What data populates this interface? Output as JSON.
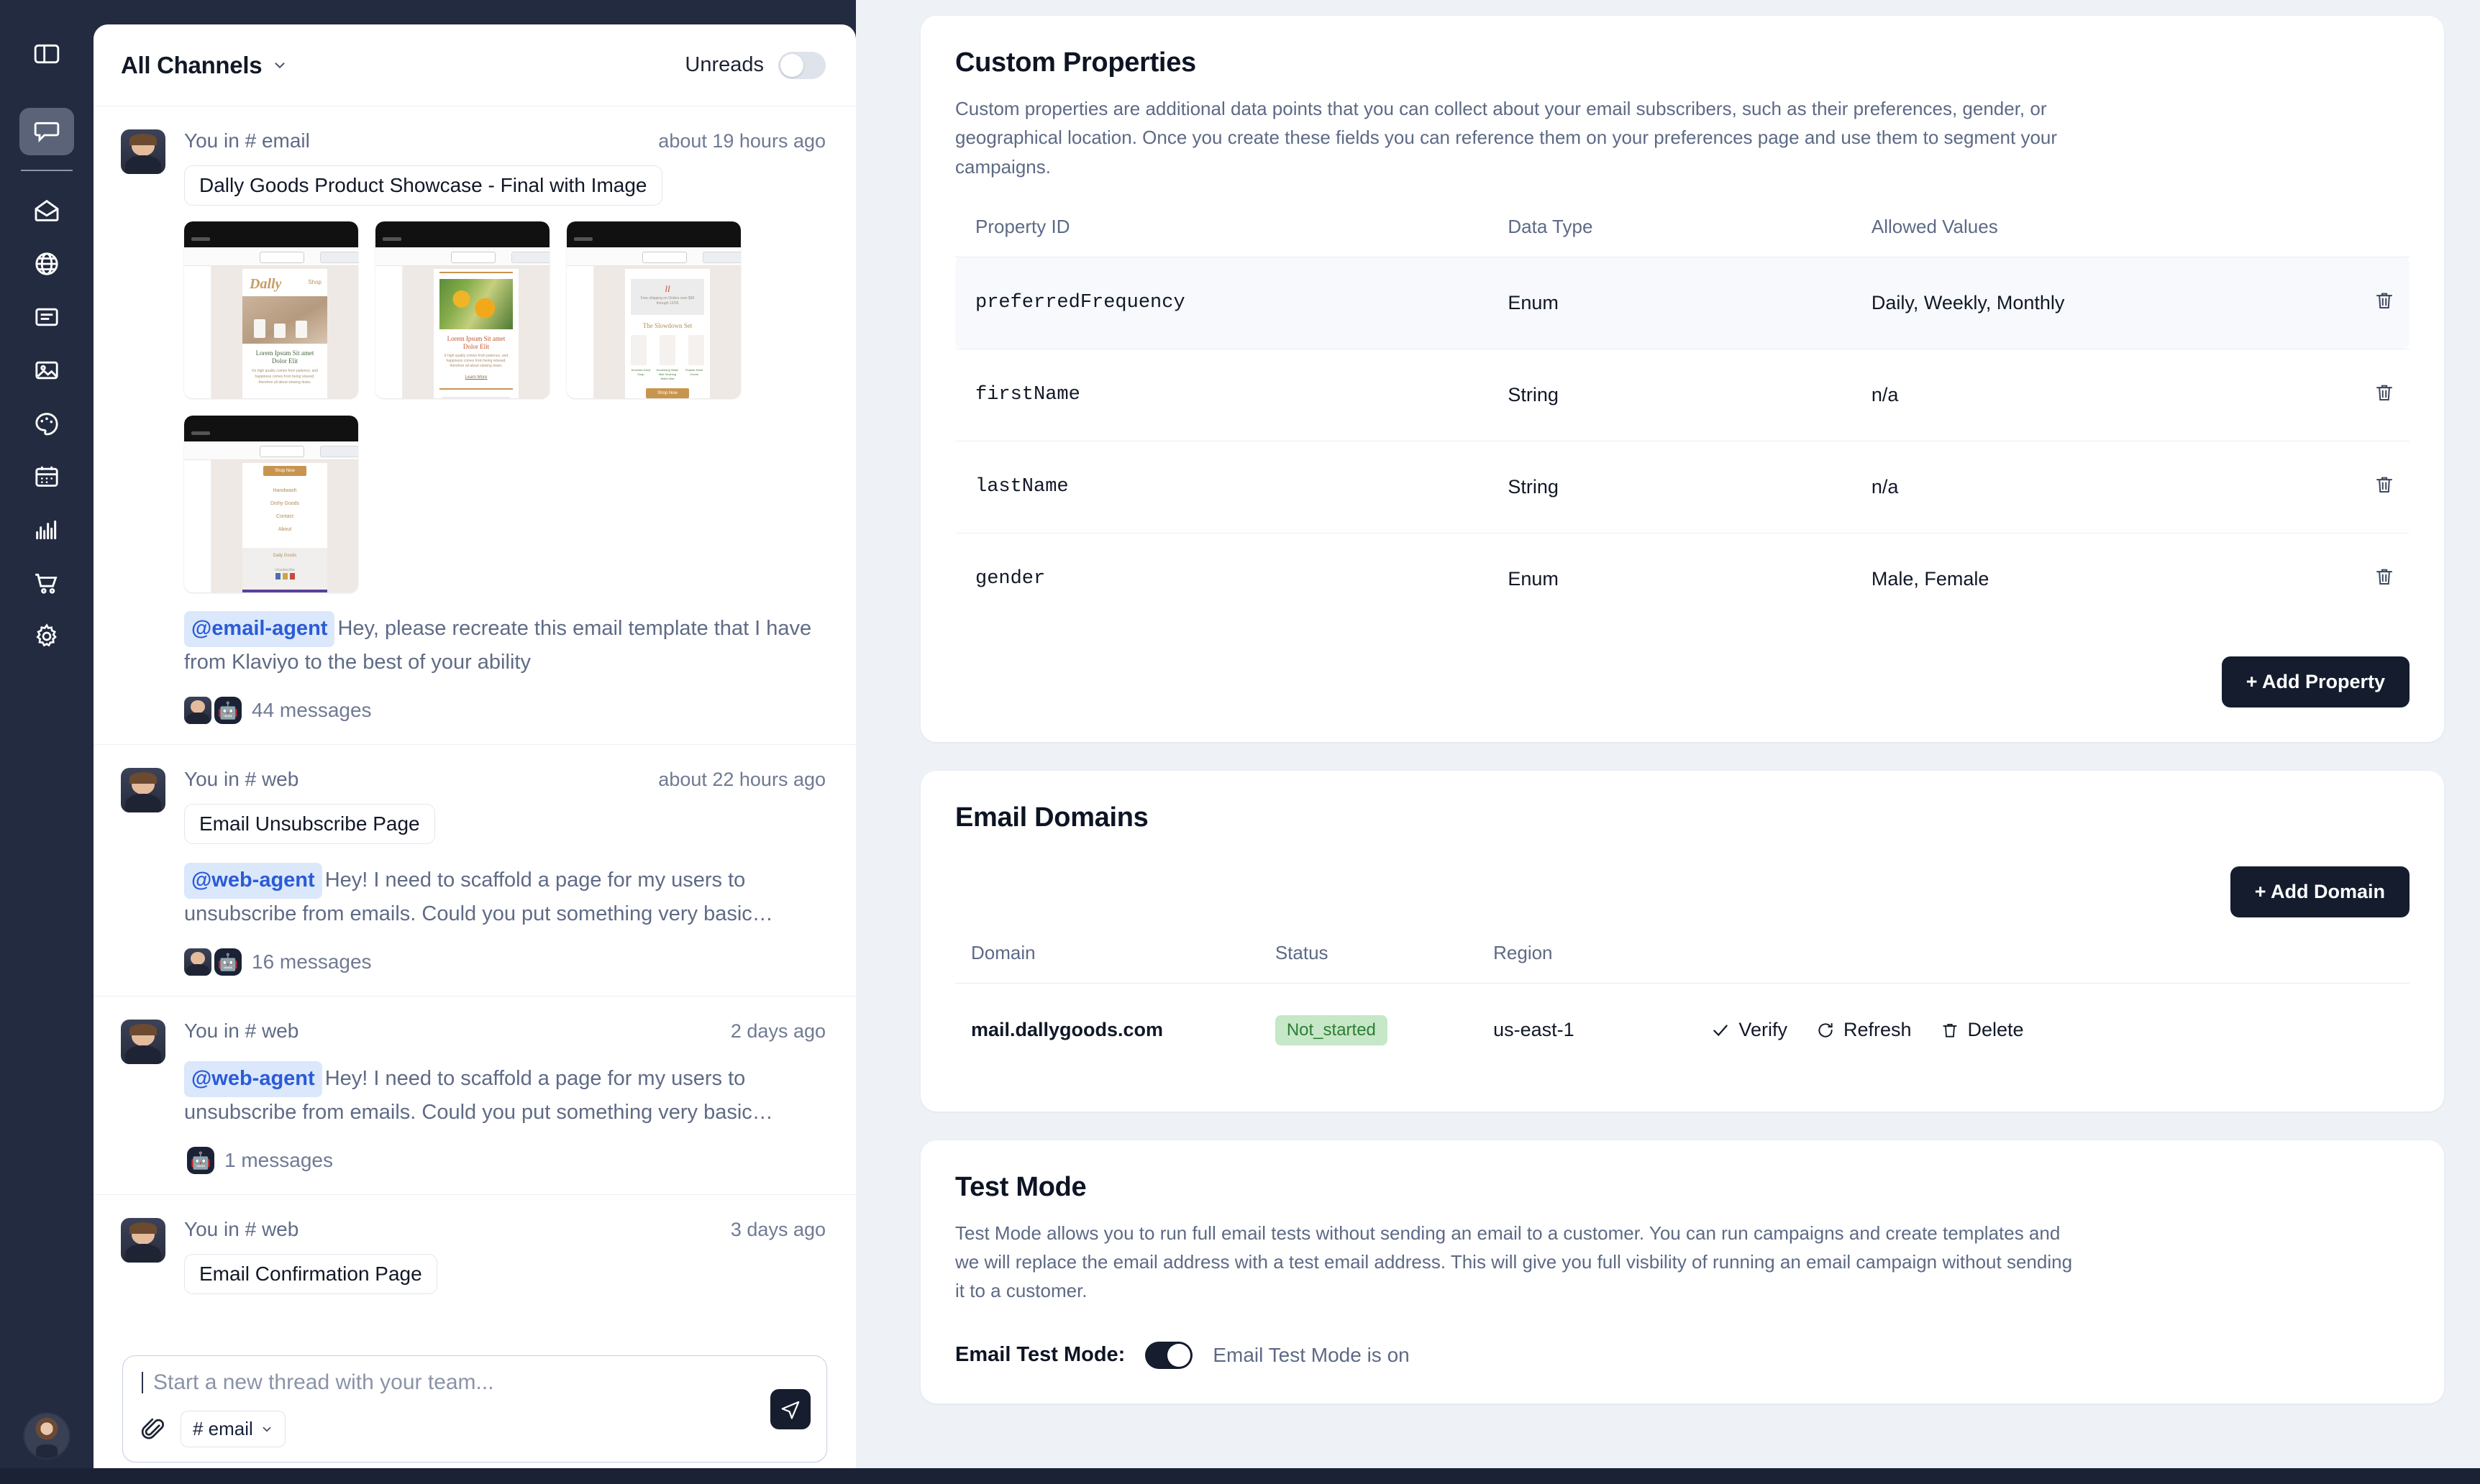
{
  "rail": {
    "items": [
      {
        "name": "panel-toggle-icon",
        "label": "Toggle panel"
      },
      {
        "name": "chat-icon",
        "label": "Chat",
        "active": true
      },
      {
        "name": "mail-icon",
        "label": "Email"
      },
      {
        "name": "globe-icon",
        "label": "Web"
      },
      {
        "name": "document-icon",
        "label": "Docs"
      },
      {
        "name": "image-icon",
        "label": "Images"
      },
      {
        "name": "palette-icon",
        "label": "Design"
      },
      {
        "name": "calendar-icon",
        "label": "Calendar"
      },
      {
        "name": "chart-icon",
        "label": "Analytics"
      },
      {
        "name": "cart-icon",
        "label": "Commerce"
      },
      {
        "name": "gear-icon",
        "label": "Settings"
      }
    ]
  },
  "chat": {
    "channel_selector": "All Channels",
    "unreads_label": "Unreads",
    "unreads_on": false,
    "threads": [
      {
        "who": "You in # email",
        "when": "about 19 hours ago",
        "chip": "Dally Goods Product Showcase - Final with Image",
        "has_shots": true,
        "mention": "@email-agent",
        "text": "Hey, please recreate this email template that I have from Klaviyo to the best of your ability",
        "participants": 2,
        "messages": "44 messages"
      },
      {
        "who": "You in # web",
        "when": "about 22 hours ago",
        "chip": "Email Unsubscribe Page",
        "has_shots": false,
        "mention": "@web-agent",
        "text": "Hey! I need to scaffold a page for my users to unsubscribe from emails. Could you put something very basic…",
        "participants": 2,
        "messages": "16 messages"
      },
      {
        "who": "You in # web",
        "when": "2 days ago",
        "chip": null,
        "has_shots": false,
        "mention": "@web-agent",
        "text": "Hey! I need to scaffold a page for my users to unsubscribe from emails. Could you put something very basic…",
        "participants": 1,
        "messages": "1 messages"
      },
      {
        "who": "You in # web",
        "when": "3 days ago",
        "chip": "Email Confirmation Page",
        "has_shots": false,
        "mention": null,
        "text": null,
        "participants": 0,
        "messages": null
      }
    ],
    "composer": {
      "placeholder": "Start a new thread with your team...",
      "channel_pill": "# email",
      "send_label": "Send"
    }
  },
  "custom_properties": {
    "title": "Custom Properties",
    "description": "Custom properties are additional data points that you can collect about your email subscribers, such as their preferences, gender, or geographical location. Once you create these fields you can reference them on your preferences page and use them to segment your campaigns.",
    "columns": [
      "Property ID",
      "Data Type",
      "Allowed Values"
    ],
    "rows": [
      {
        "id": "preferredFrequency",
        "type": "Enum",
        "values": "Daily, Weekly, Monthly",
        "muted": false,
        "highlight": true
      },
      {
        "id": "firstName",
        "type": "String",
        "values": "n/a",
        "muted": true,
        "highlight": false
      },
      {
        "id": "lastName",
        "type": "String",
        "values": "n/a",
        "muted": true,
        "highlight": false
      },
      {
        "id": "gender",
        "type": "Enum",
        "values": "Male, Female",
        "muted": false,
        "highlight": false
      }
    ],
    "add_button": "+ Add Property"
  },
  "email_domains": {
    "title": "Email Domains",
    "add_button": "+ Add Domain",
    "columns": [
      "Domain",
      "Status",
      "Region"
    ],
    "rows": [
      {
        "domain": "mail.dallygoods.com",
        "status": "Not_started",
        "region": "us-east-1",
        "actions": [
          "Verify",
          "Refresh",
          "Delete"
        ]
      }
    ]
  },
  "test_mode": {
    "title": "Test Mode",
    "description": "Test Mode allows you to run full email tests without sending an email to a customer. You can run campaigns and create templates and we will replace the email address with a test email address. This will give you full visbility of running an email campaign without sending it to a customer.",
    "toggle_label": "Email Test Mode:",
    "toggle_on": true,
    "state_text": "Email Test Mode is on"
  },
  "colors": {
    "rail_bg": "#232b40",
    "page_bg": "#eef1f6",
    "accent_dark": "#141c2e",
    "mention_bg": "#dbe7fb",
    "mention_fg": "#2a5bd7",
    "badge_bg": "#c6e7c8",
    "badge_fg": "#2e7d32"
  }
}
